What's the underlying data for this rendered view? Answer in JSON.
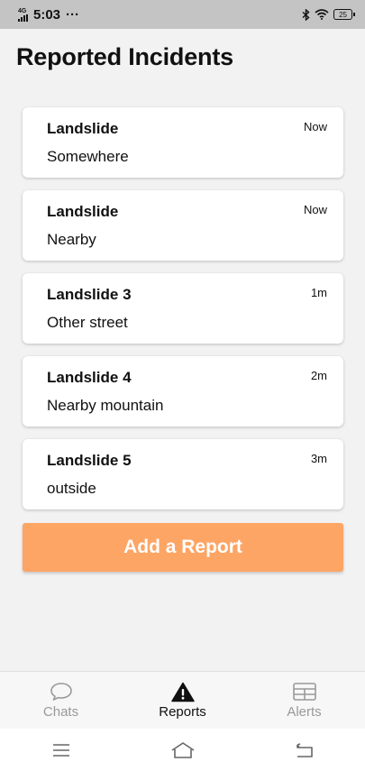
{
  "status_bar": {
    "network": "4G",
    "time": "5:03",
    "dots": "···",
    "battery": "25",
    "icons": [
      "signal-icon",
      "bluetooth-icon",
      "wifi-icon",
      "battery-icon"
    ]
  },
  "page": {
    "title": "Reported Incidents"
  },
  "incidents": [
    {
      "title": "Landslide",
      "location": "Somewhere",
      "time": "Now"
    },
    {
      "title": "Landslide",
      "location": "Nearby",
      "time": "Now"
    },
    {
      "title": "Landslide 3",
      "location": "Other street",
      "time": "1m"
    },
    {
      "title": "Landslide 4",
      "location": "Nearby mountain",
      "time": "2m"
    },
    {
      "title": "Landslide 5",
      "location": "outside",
      "time": "3m"
    }
  ],
  "add_button": {
    "label": "Add a Report",
    "color": "#fda564"
  },
  "tabs": [
    {
      "label": "Chats",
      "icon": "chat-bubble-icon",
      "active": false
    },
    {
      "label": "Reports",
      "icon": "warning-icon",
      "active": true
    },
    {
      "label": "Alerts",
      "icon": "table-grid-icon",
      "active": false
    }
  ],
  "system_nav": [
    "menu-icon",
    "home-icon",
    "back-icon"
  ],
  "colors": {
    "accent": "#fda564",
    "status_bar": "#c4c4c4",
    "background": "#f2f2f2",
    "inactive_tab": "#999999"
  }
}
